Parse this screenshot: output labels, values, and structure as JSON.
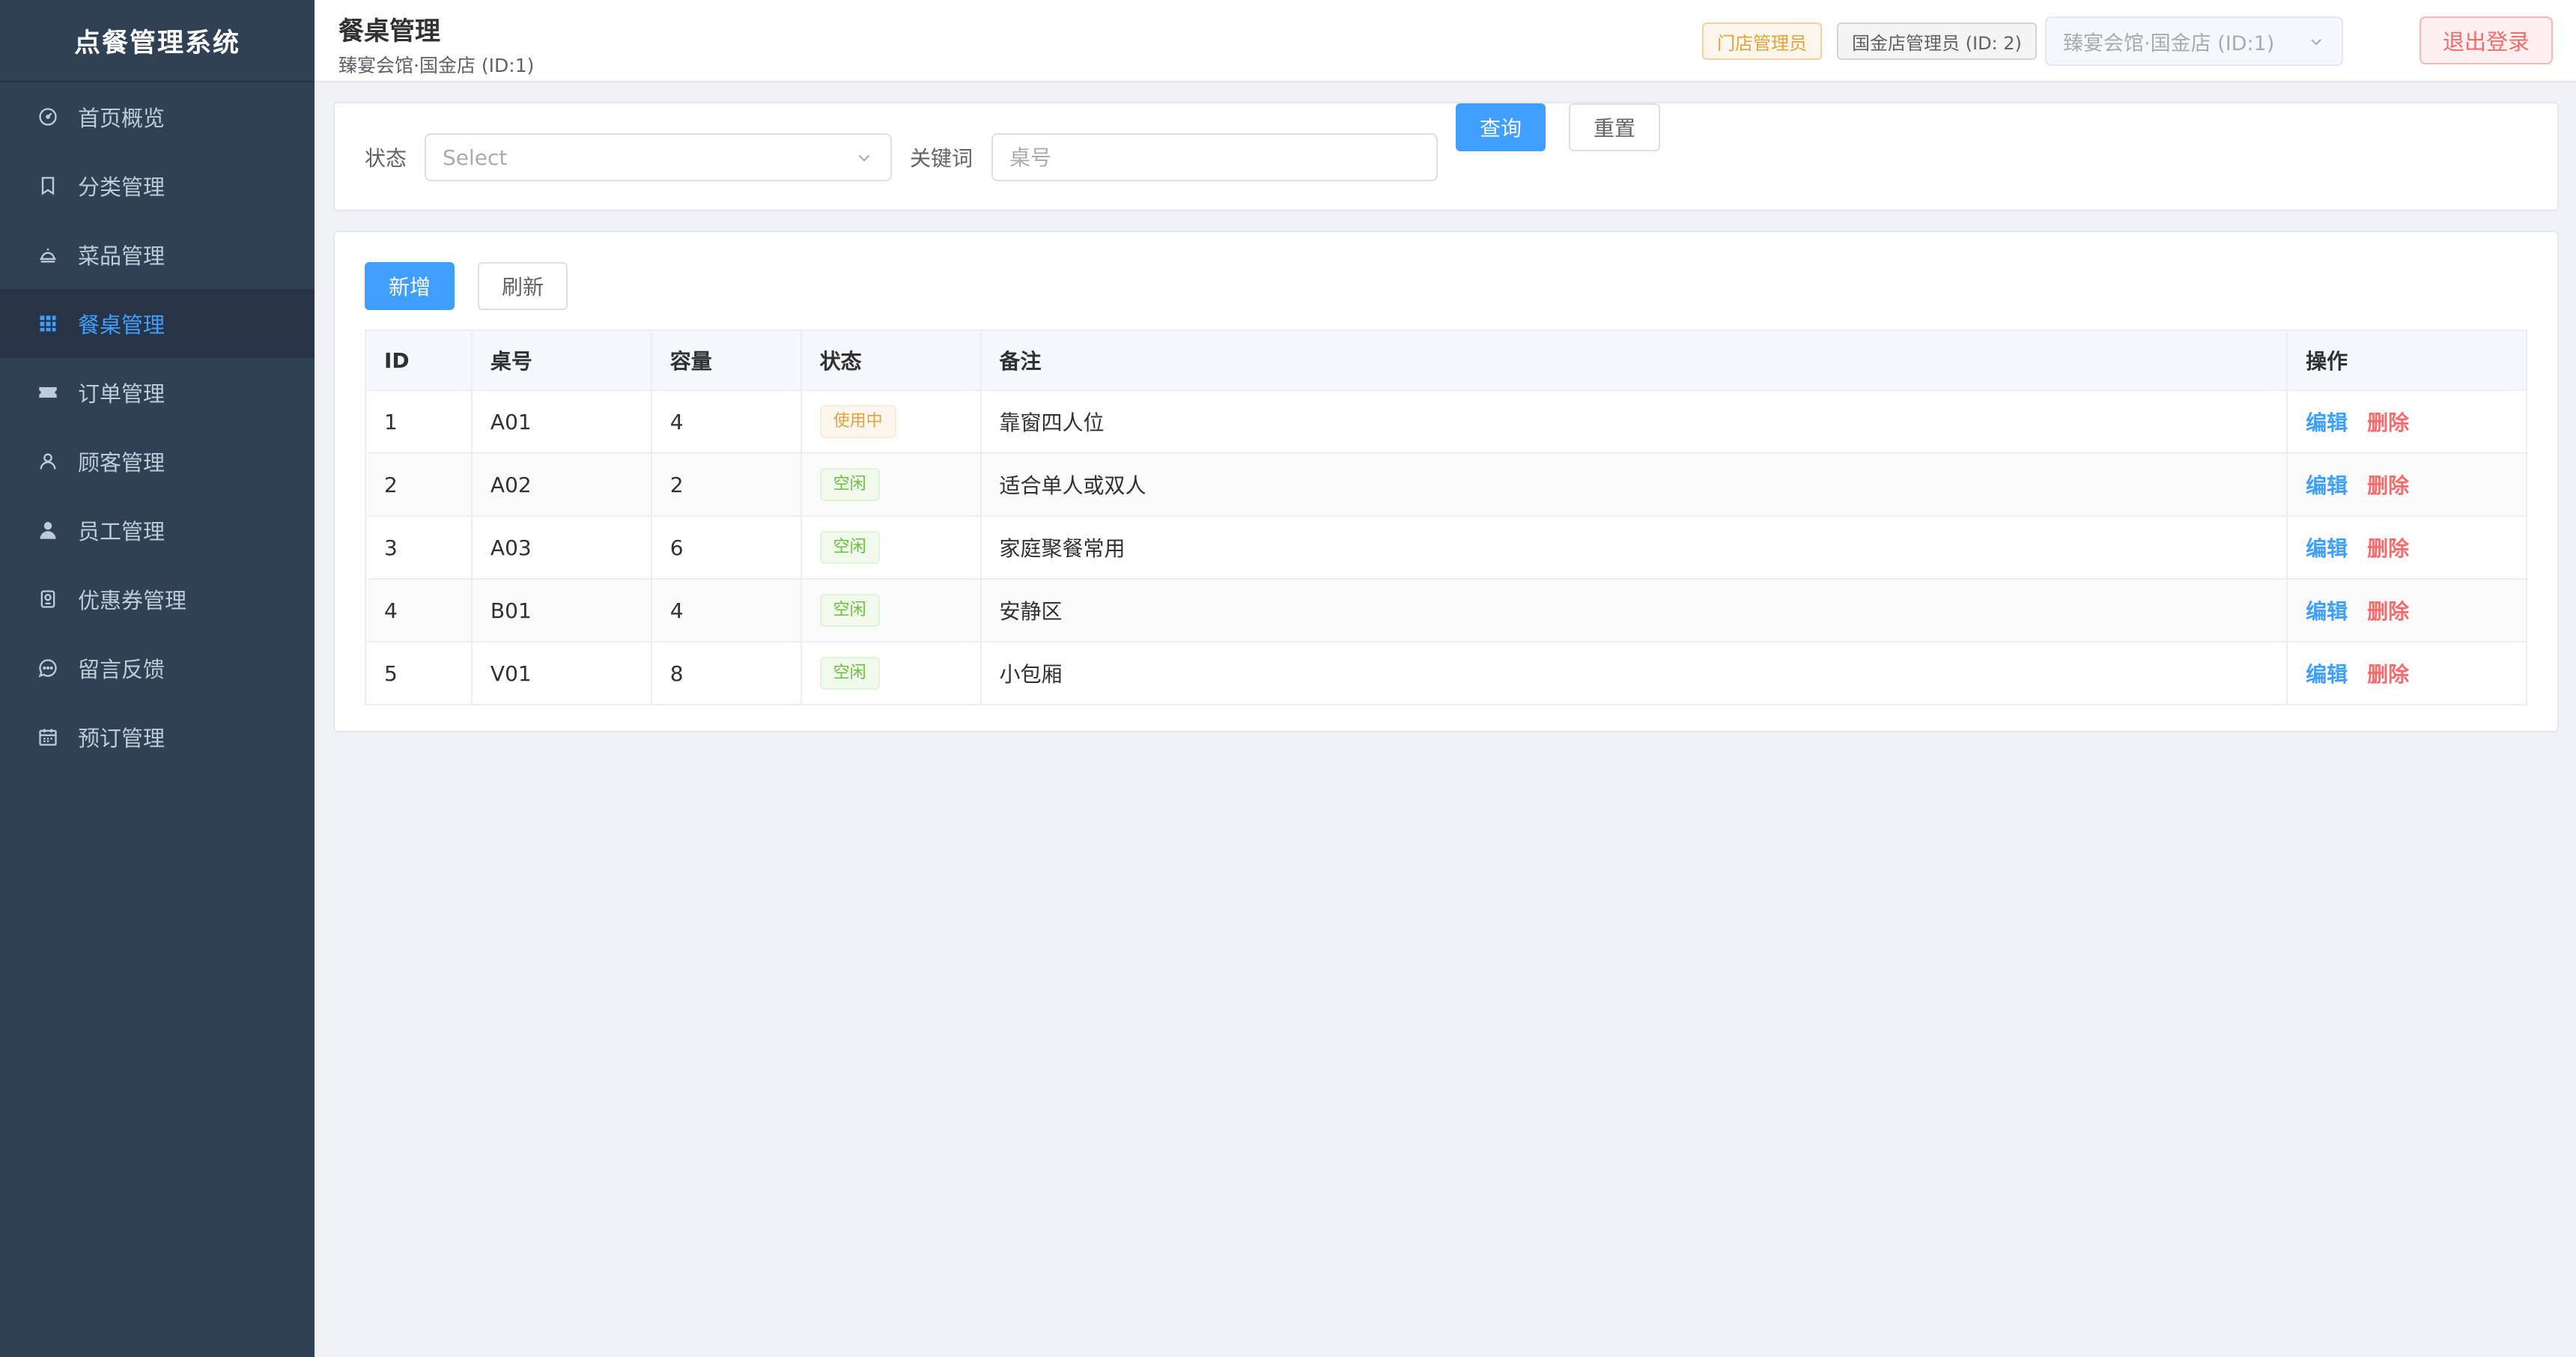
{
  "app": {
    "title": "点餐管理系统"
  },
  "sidebar": {
    "items": [
      {
        "label": "首页概览",
        "icon": "dashboard-icon"
      },
      {
        "label": "分类管理",
        "icon": "bookmark-icon"
      },
      {
        "label": "菜品管理",
        "icon": "dish-icon"
      },
      {
        "label": "餐桌管理",
        "icon": "grid-icon",
        "active": true
      },
      {
        "label": "订单管理",
        "icon": "ticket-icon"
      },
      {
        "label": "顾客管理",
        "icon": "user-icon"
      },
      {
        "label": "员工管理",
        "icon": "staff-icon"
      },
      {
        "label": "优惠券管理",
        "icon": "coupon-icon"
      },
      {
        "label": "留言反馈",
        "icon": "chat-icon"
      },
      {
        "label": "预订管理",
        "icon": "calendar-icon"
      }
    ]
  },
  "header": {
    "title": "餐桌管理",
    "subtitle": "臻宴会馆·国金店 (ID:1)",
    "role_tag": "门店管理员",
    "user_tag": "国金店管理员 (ID: 2)",
    "store_select": "臻宴会馆·国金店 (ID:1)",
    "logout": "退出登录"
  },
  "filters": {
    "status_label": "状态",
    "status_placeholder": "Select",
    "keyword_label": "关键词",
    "keyword_placeholder": "桌号",
    "search": "查询",
    "reset": "重置"
  },
  "toolbar": {
    "add": "新增",
    "refresh": "刷新"
  },
  "table": {
    "columns": [
      "ID",
      "桌号",
      "容量",
      "状态",
      "备注",
      "操作"
    ],
    "rows": [
      {
        "id": "1",
        "no": "A01",
        "capacity": "4",
        "status": "使用中",
        "note": "靠窗四人位"
      },
      {
        "id": "2",
        "no": "A02",
        "capacity": "2",
        "status": "空闲",
        "note": "适合单人或双人"
      },
      {
        "id": "3",
        "no": "A03",
        "capacity": "6",
        "status": "空闲",
        "note": "家庭聚餐常用"
      },
      {
        "id": "4",
        "no": "B01",
        "capacity": "4",
        "status": "空闲",
        "note": "安静区"
      },
      {
        "id": "5",
        "no": "V01",
        "capacity": "8",
        "status": "空闲",
        "note": "小包厢"
      }
    ],
    "edit": "编辑",
    "delete": "删除"
  },
  "colors": {
    "primary": "#409eff",
    "danger": "#f56c6c",
    "warning": "#e6a23c",
    "success": "#67c23a",
    "sidebar": "#304156"
  }
}
